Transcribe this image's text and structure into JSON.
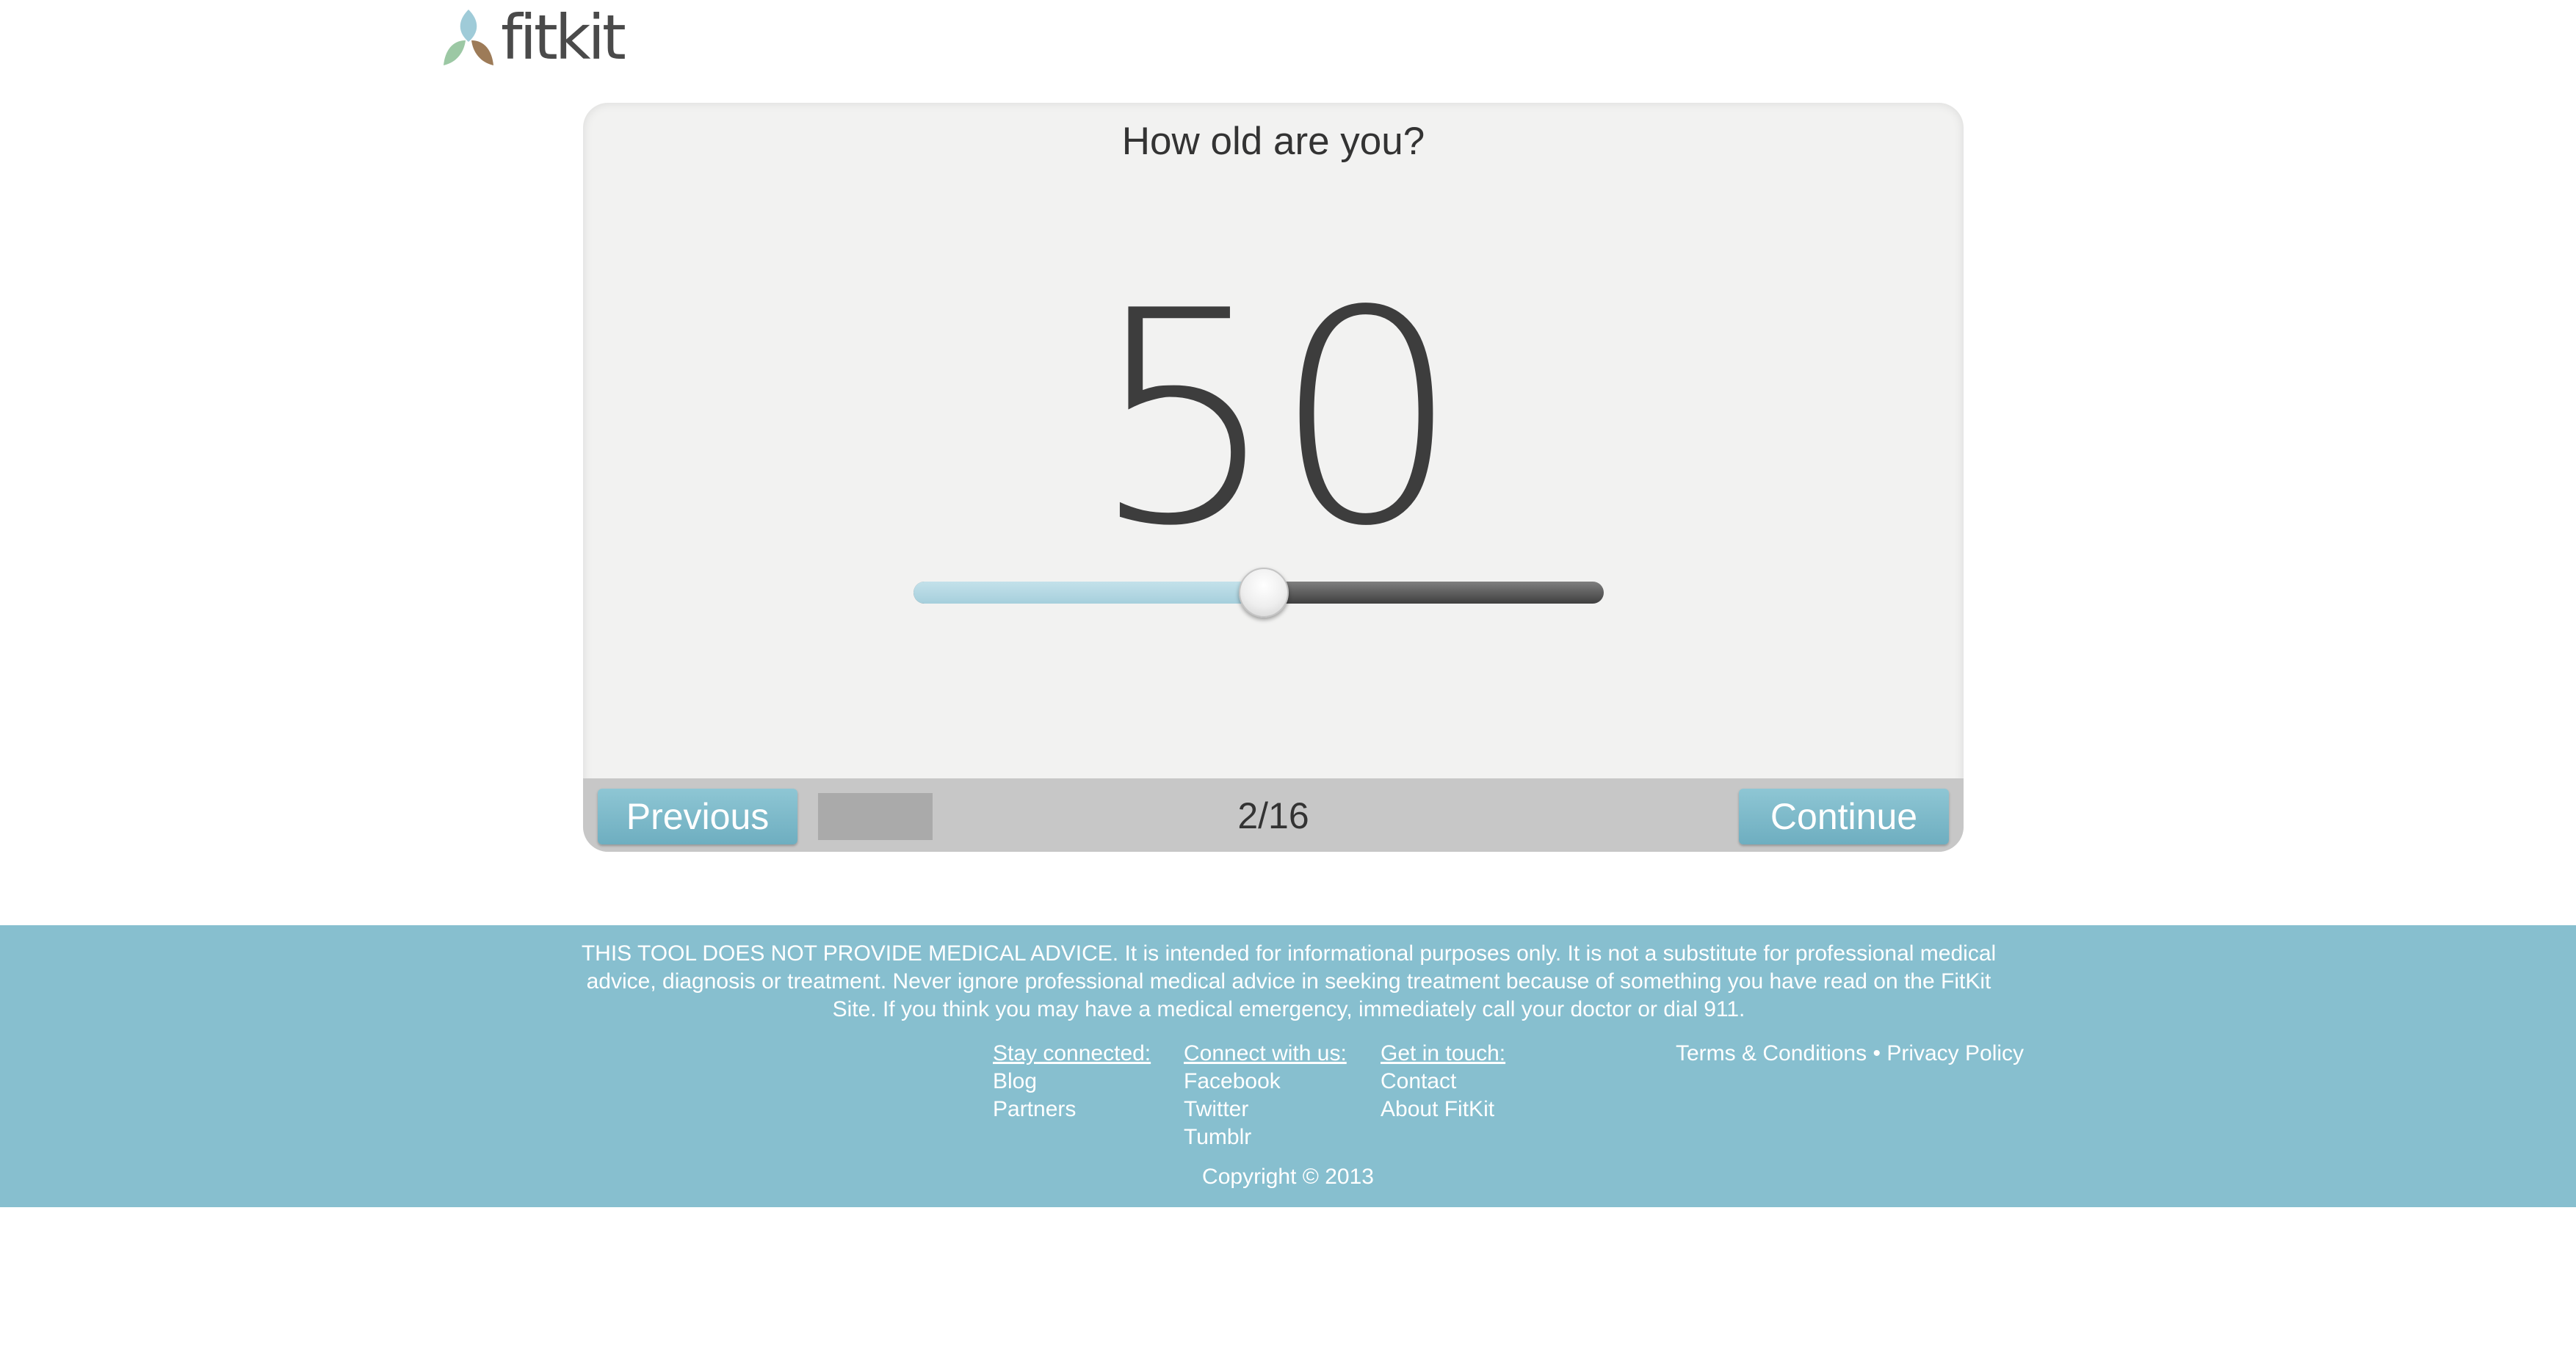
{
  "brand": {
    "logo_text": "fitkit",
    "colors": {
      "accent": "#87bfcf",
      "button": "#7ab8c9",
      "leaf_green": "#9cc8a4",
      "leaf_blue": "#9fcbd8",
      "leaf_brown": "#9d7b58"
    }
  },
  "quiz": {
    "question": "How old are you?",
    "value": "50",
    "slider_fraction": 0.505,
    "previous_label": "Previous",
    "continue_label": "Continue",
    "page_counter": "2/16"
  },
  "footer": {
    "disclaimer": "THIS TOOL DOES NOT PROVIDE MEDICAL ADVICE. It is intended for informational purposes only. It is not a substitute for professional medical advice, diagnosis or treatment. Never ignore professional medical advice in seeking treatment because of something you have read on the FitKit Site. If you think you may have a medical emergency, immediately call your doctor or dial 911.",
    "stay_connected": {
      "title": "Stay connected:",
      "links": [
        "Blog",
        "Partners"
      ]
    },
    "connect_with_us": {
      "title": "Connect with us:",
      "links": [
        "Facebook",
        "Twitter",
        "Tumblr"
      ]
    },
    "get_in_touch": {
      "title": "Get in touch:",
      "links": [
        "Contact",
        "About FitKit"
      ]
    },
    "terms_label": "Terms & Conditions",
    "separator": "•",
    "privacy_label": "Privacy Policy",
    "copyright": "Copyright © 2013"
  }
}
